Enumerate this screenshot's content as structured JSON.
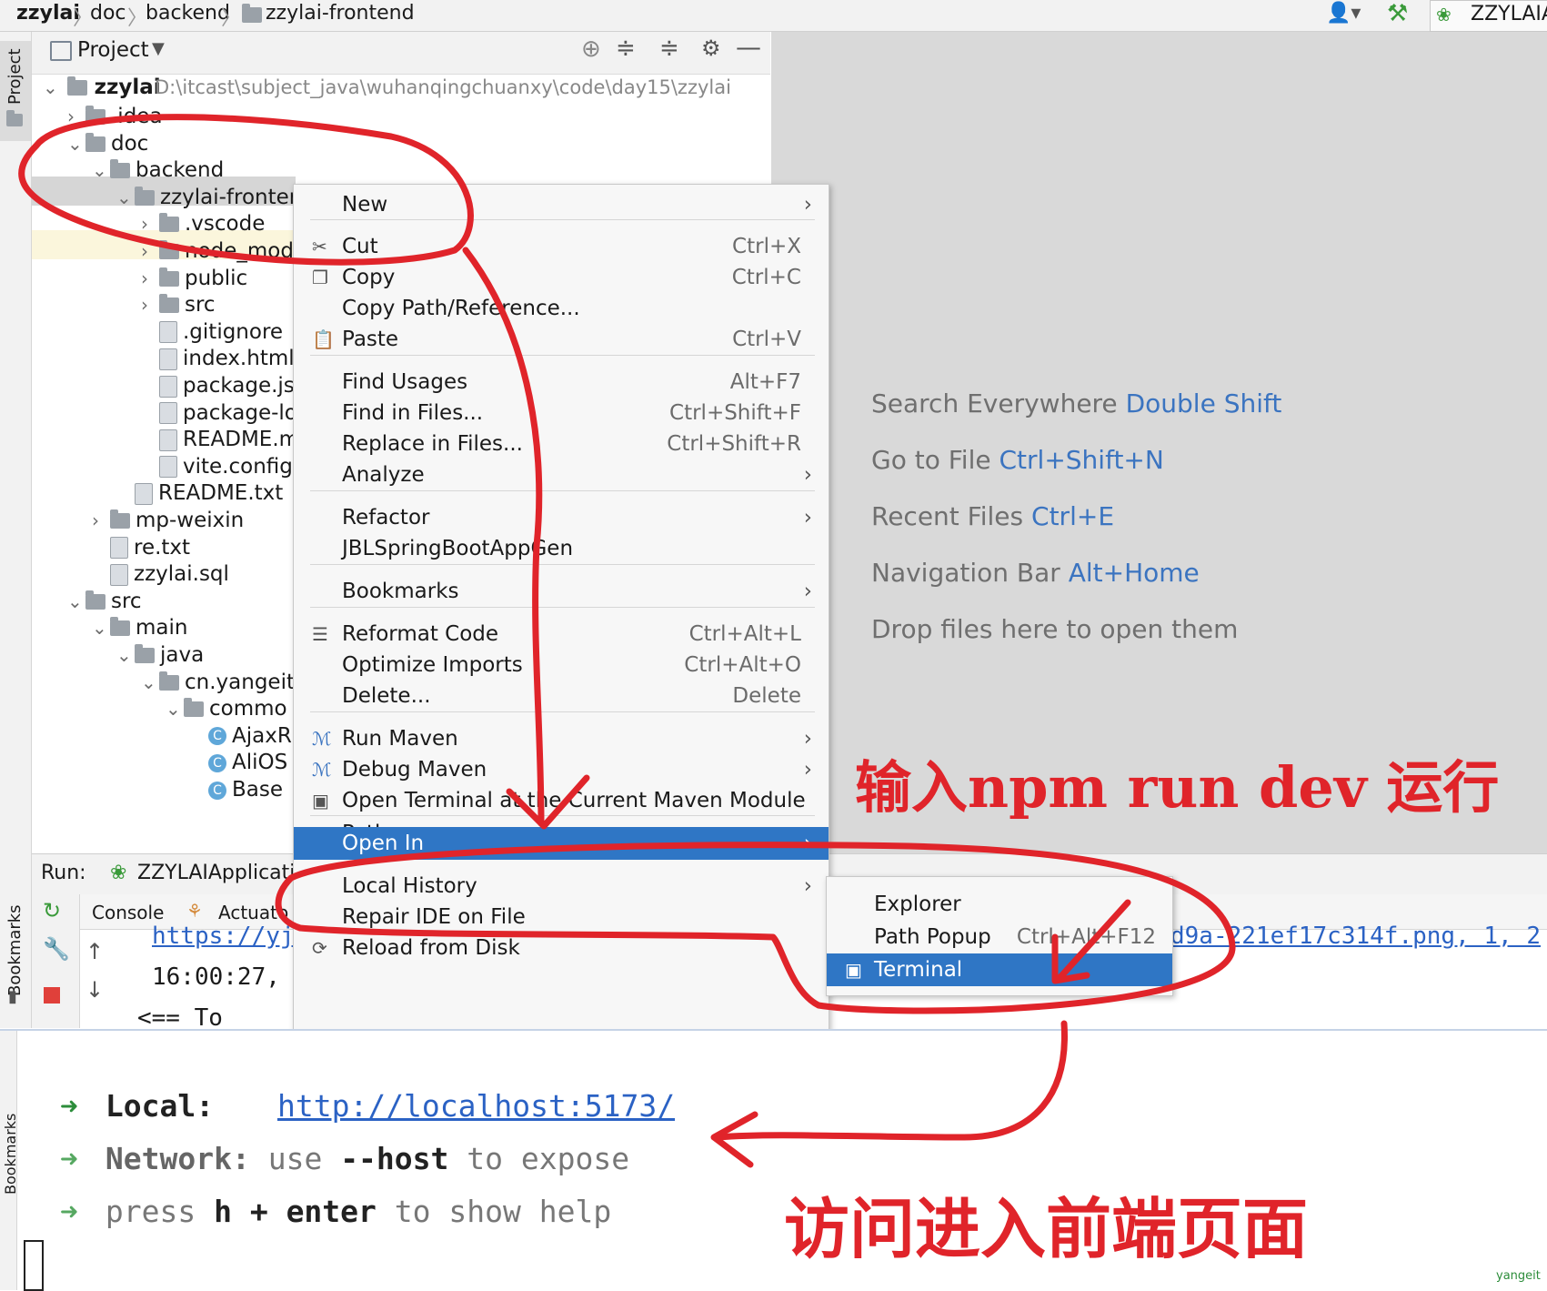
{
  "breadcrumb": {
    "items": [
      "zzylai",
      "doc",
      "backend",
      "zzylai-frontend"
    ],
    "run_config": "ZZYLAIA"
  },
  "tool_strip": {
    "project_label": "Project",
    "bookmarks_label": "Bookmarks"
  },
  "project_panel": {
    "title": "Project",
    "root_name": "zzylai",
    "root_path": "D:\\itcast\\subject_java\\wuhanqingchuanxy\\code\\day15\\zzylai",
    "tree": [
      {
        "label": ".idea",
        "chevron": ">",
        "icon": "folder"
      },
      {
        "label": "doc",
        "chevron": "v",
        "icon": "folder"
      },
      {
        "label": "backend",
        "chevron": "v",
        "icon": "folder"
      },
      {
        "label": "zzylai-fronter",
        "chevron": "v",
        "icon": "folder"
      },
      {
        "label": ".vscode",
        "chevron": ">",
        "icon": "folder"
      },
      {
        "label": "node_mod",
        "chevron": ">",
        "icon": "folder"
      },
      {
        "label": "public",
        "chevron": ">",
        "icon": "folder"
      },
      {
        "label": "src",
        "chevron": ">",
        "icon": "folder"
      },
      {
        "label": ".gitignore",
        "chevron": "",
        "icon": "file"
      },
      {
        "label": "index.html",
        "chevron": "",
        "icon": "file"
      },
      {
        "label": "package.js",
        "chevron": "",
        "icon": "file"
      },
      {
        "label": "package-lo",
        "chevron": "",
        "icon": "file"
      },
      {
        "label": "README.m",
        "chevron": "",
        "icon": "file"
      },
      {
        "label": "vite.config",
        "chevron": "",
        "icon": "file"
      },
      {
        "label": "README.txt",
        "chevron": "",
        "icon": "file"
      },
      {
        "label": "mp-weixin",
        "chevron": ">",
        "icon": "folder"
      },
      {
        "label": "re.txt",
        "chevron": "",
        "icon": "file"
      },
      {
        "label": "zzylai.sql",
        "chevron": "",
        "icon": "file"
      },
      {
        "label": "src",
        "chevron": "v",
        "icon": "folder"
      },
      {
        "label": "main",
        "chevron": "v",
        "icon": "folder"
      },
      {
        "label": "java",
        "chevron": "v",
        "icon": "folder"
      },
      {
        "label": "cn.yangeit",
        "chevron": "v",
        "icon": "folder"
      },
      {
        "label": "commo",
        "chevron": "v",
        "icon": "folder"
      },
      {
        "label": "AjaxR",
        "chevron": "",
        "icon": "class"
      },
      {
        "label": "AliOS",
        "chevron": "",
        "icon": "class"
      },
      {
        "label": "Base",
        "chevron": "",
        "icon": "class"
      }
    ]
  },
  "editor_hints": [
    {
      "text": "Search Everywhere",
      "key": "Double Shift"
    },
    {
      "text": "Go to File",
      "key": "Ctrl+Shift+N"
    },
    {
      "text": "Recent Files",
      "key": "Ctrl+E"
    },
    {
      "text": "Navigation Bar",
      "key": "Alt+Home"
    },
    {
      "text": "Drop files here to open them",
      "key": ""
    }
  ],
  "context_menu": {
    "items": [
      {
        "label": "New",
        "shortcut": "",
        "arrow": "›"
      },
      {
        "label": "Cut",
        "shortcut": "Ctrl+X",
        "arrow": ""
      },
      {
        "label": "Copy",
        "shortcut": "Ctrl+C",
        "arrow": ""
      },
      {
        "label": "Copy Path/Reference...",
        "shortcut": "",
        "arrow": ""
      },
      {
        "label": "Paste",
        "shortcut": "Ctrl+V",
        "arrow": ""
      },
      {
        "label": "Find Usages",
        "shortcut": "Alt+F7",
        "arrow": ""
      },
      {
        "label": "Find in Files...",
        "shortcut": "Ctrl+Shift+F",
        "arrow": ""
      },
      {
        "label": "Replace in Files...",
        "shortcut": "Ctrl+Shift+R",
        "arrow": ""
      },
      {
        "label": "Analyze",
        "shortcut": "",
        "arrow": "›"
      },
      {
        "label": "Refactor",
        "shortcut": "",
        "arrow": "›"
      },
      {
        "label": "JBLSpringBootAppGen",
        "shortcut": "",
        "arrow": ""
      },
      {
        "label": "Bookmarks",
        "shortcut": "",
        "arrow": "›"
      },
      {
        "label": "Reformat Code",
        "shortcut": "Ctrl+Alt+L",
        "arrow": ""
      },
      {
        "label": "Optimize Imports",
        "shortcut": "Ctrl+Alt+O",
        "arrow": ""
      },
      {
        "label": "Delete...",
        "shortcut": "Delete",
        "arrow": ""
      },
      {
        "label": "Run Maven",
        "shortcut": "",
        "arrow": "›"
      },
      {
        "label": "Debug Maven",
        "shortcut": "",
        "arrow": "›"
      },
      {
        "label": "Open Terminal at the Current Maven Module Path",
        "shortcut": "",
        "arrow": ""
      },
      {
        "label": "Open In",
        "shortcut": "",
        "arrow": "›"
      },
      {
        "label": "Local History",
        "shortcut": "",
        "arrow": "›"
      },
      {
        "label": "Repair IDE on File",
        "shortcut": "",
        "arrow": ""
      },
      {
        "label": "Reload from Disk",
        "shortcut": "",
        "arrow": ""
      }
    ]
  },
  "submenu": {
    "items": [
      {
        "label": "Explorer",
        "shortcut": ""
      },
      {
        "label": "Path Popup",
        "shortcut": "Ctrl+Alt+F12"
      },
      {
        "label": "Terminal",
        "shortcut": ""
      }
    ]
  },
  "run_panel": {
    "label": "Run:",
    "config": "ZZYLAIApplicatio",
    "tabs": [
      "Console",
      "Actuato"
    ],
    "lines": [
      "https://yj",
      "16:00:27,",
      "<==      To"
    ],
    "tail_text": "d9a-221ef17c314f.png, 1, 2"
  },
  "terminal": {
    "local_label": "Local:",
    "local_url": "http://localhost:5173/",
    "network_label": "Network:",
    "network_use": "use",
    "network_flag": "--host",
    "network_rest": "to expose",
    "press": "press",
    "press_key": "h + enter",
    "press_rest": "to show help",
    "arrow": "➜"
  },
  "annotations": {
    "run_hint": "输入npm run dev 运行",
    "visit_hint": "访问进入前端页面",
    "watermark": "yangeit"
  },
  "colors": {
    "accent": "#2f76c5",
    "annotation_red": "#e0242a",
    "terminal_arrow": "#2c8d3a"
  }
}
